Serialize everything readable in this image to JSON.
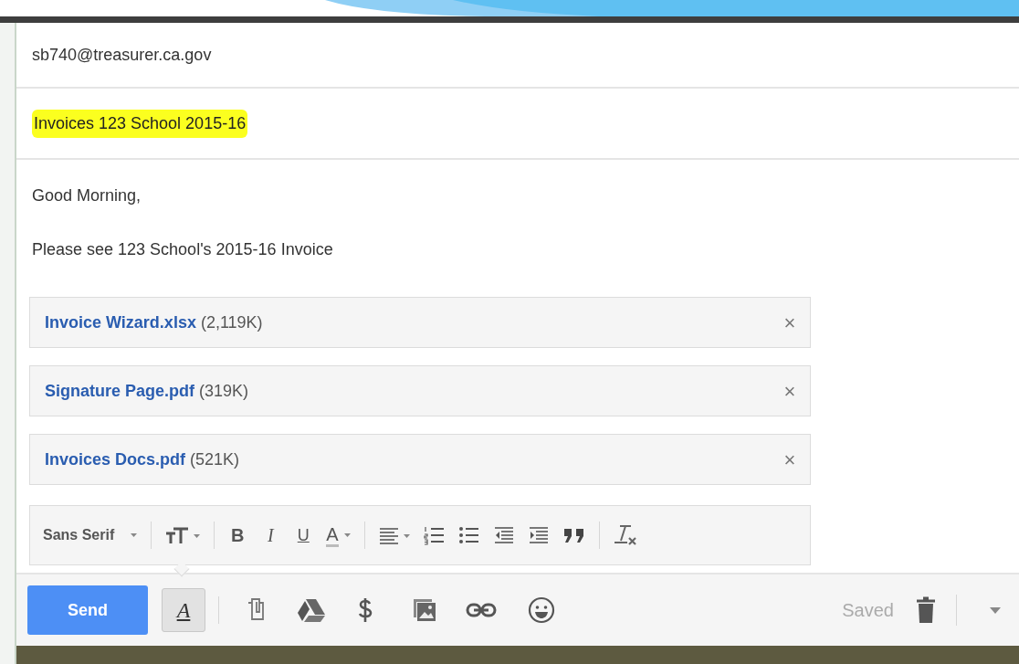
{
  "to": {
    "value": "sb740@treasurer.ca.gov"
  },
  "subject": {
    "value": "Invoices 123 School 2015-16",
    "highlighted": true
  },
  "body": [
    "Good Morning,",
    "Please see 123 School's 2015-16 Invoice"
  ],
  "attachments": [
    {
      "name": "Invoice Wizard.xlsx",
      "size": "(2,119K)",
      "remove": "×"
    },
    {
      "name": "Signature Page.pdf",
      "size": "(319K)",
      "remove": "×"
    },
    {
      "name": "Invoices Docs.pdf",
      "size": "(521K)",
      "remove": "×"
    }
  ],
  "format_toolbar": [
    {
      "kind": "font",
      "label": "Sans Serif"
    },
    {
      "kind": "sep"
    },
    {
      "kind": "size"
    },
    {
      "kind": "sep"
    },
    {
      "kind": "bold",
      "label": "B"
    },
    {
      "kind": "italic",
      "label": "I"
    },
    {
      "kind": "underline",
      "label": "U"
    },
    {
      "kind": "color",
      "label": "A"
    },
    {
      "kind": "sep"
    },
    {
      "kind": "align"
    },
    {
      "kind": "numbered"
    },
    {
      "kind": "bulleted"
    },
    {
      "kind": "outdent"
    },
    {
      "kind": "indent"
    },
    {
      "kind": "quote"
    },
    {
      "kind": "sep"
    },
    {
      "kind": "clear"
    }
  ],
  "bottom_bar": {
    "send": "Send",
    "formatting_toggle": {
      "label": "A",
      "selected": true
    },
    "status": "Saved"
  }
}
